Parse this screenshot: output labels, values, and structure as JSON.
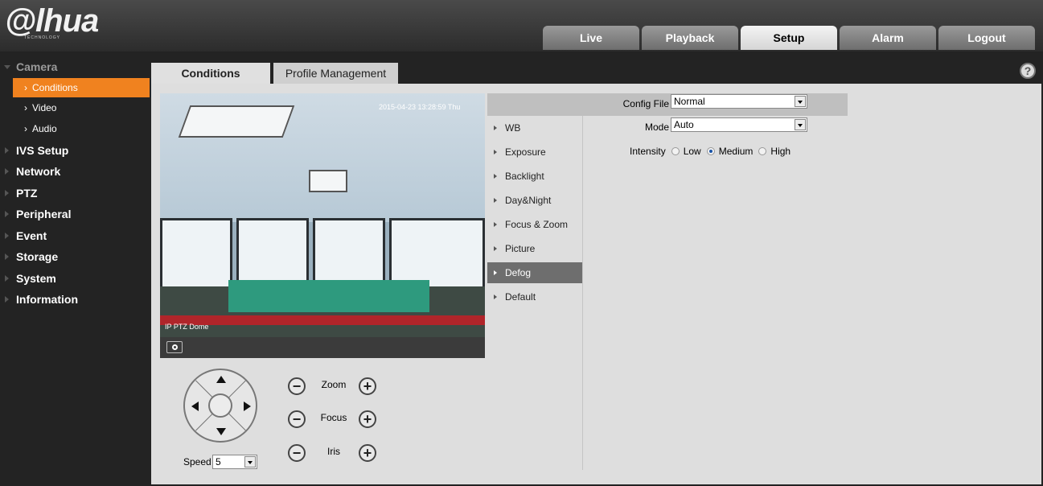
{
  "brand": {
    "logo_text": "@lhua",
    "logo_sub": "TECHNOLOGY"
  },
  "nav": {
    "items": [
      "Live",
      "Playback",
      "Setup",
      "Alarm",
      "Logout"
    ],
    "active": "Setup"
  },
  "sidebar": {
    "camera_label": "Camera",
    "sub_items": [
      "Conditions",
      "Video",
      "Audio"
    ],
    "active_sub": "Conditions",
    "categories": [
      "IVS Setup",
      "Network",
      "PTZ",
      "Peripheral",
      "Event",
      "Storage",
      "System",
      "Information"
    ]
  },
  "tabs": {
    "items": [
      "Conditions",
      "Profile Management"
    ],
    "active": "Conditions"
  },
  "help_icon": "?",
  "video": {
    "osd_time": "2015-04-23 13:28:59 Thu",
    "osd_name": "IP PTZ Dome",
    "snapshot_icon": "camera-icon"
  },
  "ptz": {
    "zoom_label": "Zoom",
    "focus_label": "Focus",
    "iris_label": "Iris",
    "minus": "−",
    "plus": "+",
    "speed_label": "Speed",
    "speed_value": "5"
  },
  "conditions_menu": {
    "items": [
      "WB",
      "Exposure",
      "Backlight",
      "Day&Night",
      "Focus & Zoom",
      "Picture",
      "Defog",
      "Default"
    ],
    "active": "Defog"
  },
  "form": {
    "config_file_label": "Config File",
    "config_file_value": "Normal",
    "mode_label": "Mode",
    "mode_value": "Auto",
    "intensity_label": "Intensity",
    "intensity_options": [
      "Low",
      "Medium",
      "High"
    ],
    "intensity_selected": "Medium"
  },
  "colors": {
    "accent_orange": "#f0821f",
    "active_menu": "#6e6e6e",
    "background": "#232323",
    "panel": "#dedede"
  }
}
